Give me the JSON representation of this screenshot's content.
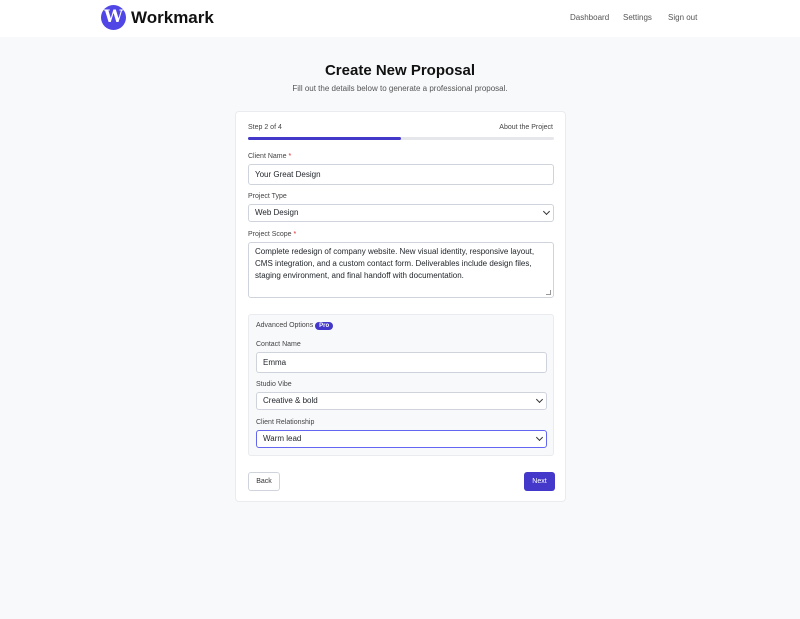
{
  "header": {
    "brand": "Workmark",
    "logo_letter": "W",
    "nav": [
      "Dashboard",
      "Settings",
      "Sign out"
    ]
  },
  "page": {
    "title": "Create New Proposal",
    "subtitle": "Fill out the details below to generate a professional proposal."
  },
  "wizard": {
    "step_text": "Step 2 of 4",
    "section_title": "About the Project",
    "progress": 0.5
  },
  "form": {
    "client_name": {
      "label": "Client Name",
      "required_mark": "*",
      "value": "Your Great Design"
    },
    "project_type": {
      "label": "Project Type",
      "value": "Web Design"
    },
    "project_scope": {
      "label": "Project Scope",
      "required_mark": "*",
      "value": "Complete redesign of company website. New visual identity, responsive layout, CMS integration, and a custom contact form. Deliverables include design files, staging environment, and final handoff with documentation."
    }
  },
  "advanced": {
    "title": "Advanced Options",
    "badge": "Pro",
    "contact_name": {
      "label": "Contact Name",
      "value": "Emma"
    },
    "studio_vibe": {
      "label": "Studio Vibe",
      "value": "Creative & bold"
    },
    "client_relationship": {
      "label": "Client Relationship",
      "value": "Warm lead"
    }
  },
  "actions": {
    "back": "Back",
    "next": "Next"
  },
  "colors": {
    "accent": "#4338ca",
    "logo": "#4f46e5",
    "required": "#dc2626"
  }
}
